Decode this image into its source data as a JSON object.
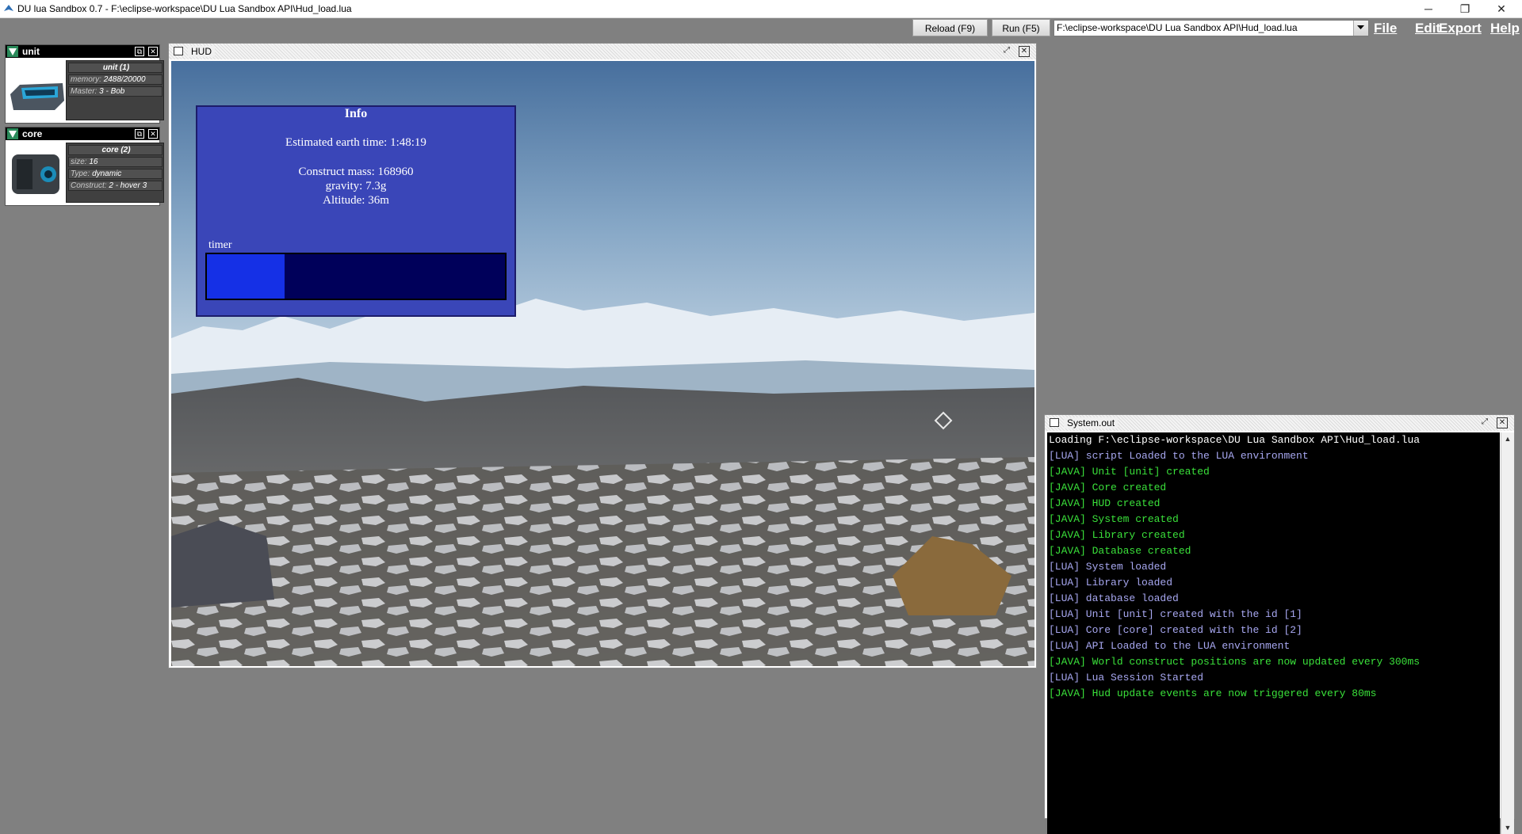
{
  "window": {
    "title": "DU lua Sandbox 0.7 - F:\\eclipse-workspace\\DU Lua Sandbox API\\Hud_load.lua",
    "controls": {
      "minimize": "─",
      "maximize": "❐",
      "close": "✕"
    }
  },
  "toolbar": {
    "reload_label": "Reload (F9)",
    "run_label": "Run (F5)",
    "script_path": "F:\\eclipse-workspace\\DU Lua Sandbox API\\Hud_load.lua",
    "menus": [
      "File",
      "Edit",
      "Export",
      "Help"
    ]
  },
  "widgets": [
    {
      "title": "unit",
      "header": "unit (1)",
      "rows": [
        {
          "key": "memory:",
          "value": "2488/20000"
        },
        {
          "key": "Master:",
          "value": "3 - Bob"
        }
      ]
    },
    {
      "title": "core",
      "header": "core (2)",
      "rows": [
        {
          "key": "size:",
          "value": "16"
        },
        {
          "key": "Type:",
          "value": "dynamic"
        },
        {
          "key": "Construct:",
          "value": "2 - hover 3"
        }
      ]
    }
  ],
  "hud": {
    "frame_title": "HUD",
    "panel": {
      "title": "Info",
      "earth_time": "Estimated earth time: 1:48:19",
      "mass": "Construct mass: 168960",
      "gravity": "gravity: 7.3g",
      "altitude": "Altitude: 36m",
      "timer_label": "timer",
      "timer_fraction": 0.26
    }
  },
  "console": {
    "frame_title": "System.out",
    "lines": [
      {
        "text": "Loading F:\\eclipse-workspace\\DU Lua Sandbox API\\Hud_load.lua",
        "color": "#ffffff"
      },
      {
        "text": "[LUA] script Loaded to the LUA environment",
        "color": "#a7a7f0"
      },
      {
        "text": "[JAVA] Unit [unit] created",
        "color": "#3ae03a"
      },
      {
        "text": "[JAVA] Core created",
        "color": "#3ae03a"
      },
      {
        "text": "[JAVA] HUD created",
        "color": "#3ae03a"
      },
      {
        "text": "[JAVA] System created",
        "color": "#3ae03a"
      },
      {
        "text": "[JAVA] Library created",
        "color": "#3ae03a"
      },
      {
        "text": "[JAVA] Database created",
        "color": "#3ae03a"
      },
      {
        "text": "[LUA] System loaded",
        "color": "#a7a7f0"
      },
      {
        "text": "[LUA] Library loaded",
        "color": "#a7a7f0"
      },
      {
        "text": "[LUA] database loaded",
        "color": "#a7a7f0"
      },
      {
        "text": "[LUA] Unit [unit] created with the id [1]",
        "color": "#a7a7f0"
      },
      {
        "text": "[LUA] Core [core] created with the id [2]",
        "color": "#a7a7f0"
      },
      {
        "text": "[LUA] API Loaded to the LUA environment",
        "color": "#a7a7f0"
      },
      {
        "text": "[JAVA] World construct positions are now updated every 300ms",
        "color": "#3ae03a"
      },
      {
        "text": "[LUA] Lua Session Started",
        "color": "#a7a7f0"
      },
      {
        "text": "[JAVA] Hud update events are now triggered every 80ms",
        "color": "#3ae03a"
      }
    ]
  }
}
